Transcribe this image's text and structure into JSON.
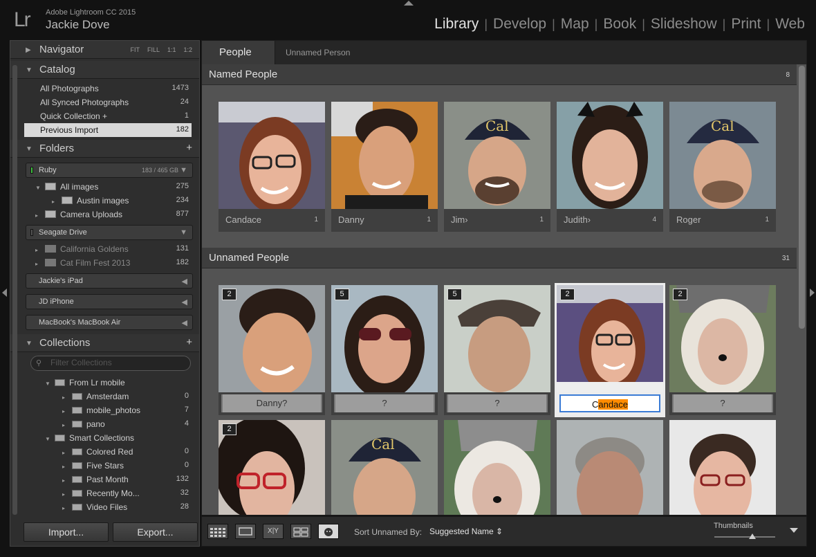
{
  "app": {
    "logo": "Lr",
    "version": "Adobe Lightroom CC 2015",
    "user": "Jackie Dove"
  },
  "modules": [
    "Library",
    "Develop",
    "Map",
    "Book",
    "Slideshow",
    "Print",
    "Web"
  ],
  "active_module": "Library",
  "navigator": {
    "title": "Navigator",
    "options": [
      "FIT",
      "FILL",
      "1:1",
      "1:2"
    ]
  },
  "catalog": {
    "title": "Catalog",
    "items": [
      {
        "label": "All Photographs",
        "count": "1473"
      },
      {
        "label": "All Synced Photographs",
        "count": "24"
      },
      {
        "label": "Quick Collection +",
        "count": "1"
      },
      {
        "label": "Previous Import",
        "count": "182"
      }
    ]
  },
  "folders": {
    "title": "Folders",
    "volume1": {
      "name": "Ruby",
      "size": "183 / 465 GB"
    },
    "items1": [
      {
        "label": "All images",
        "count": "275"
      },
      {
        "label": "Austin images",
        "count": "234"
      },
      {
        "label": "Camera Uploads",
        "count": "877"
      }
    ],
    "volume2": {
      "name": "Seagate Drive"
    },
    "items2": [
      {
        "label": "California Goldens",
        "count": "131"
      },
      {
        "label": "Cat Film Fest 2013",
        "count": "182"
      }
    ],
    "devices": [
      "Jackie's iPad",
      "JD iPhone",
      "MacBook's MacBook Air"
    ]
  },
  "collections": {
    "title": "Collections",
    "filter_placeholder": "Filter Collections",
    "sets": [
      {
        "label": "From Lr mobile"
      },
      {
        "label": "Smart Collections"
      }
    ],
    "mobile_items": [
      {
        "label": "Amsterdam",
        "count": "0"
      },
      {
        "label": "mobile_photos",
        "count": "7"
      },
      {
        "label": "pano",
        "count": "4"
      }
    ],
    "smart_items": [
      {
        "label": "Colored Red",
        "count": "0"
      },
      {
        "label": "Five Stars",
        "count": "0"
      },
      {
        "label": "Past Month",
        "count": "132"
      },
      {
        "label": "Recently Mo...",
        "count": "32"
      },
      {
        "label": "Video Files",
        "count": "28"
      }
    ]
  },
  "buttons": {
    "import": "Import...",
    "export": "Export..."
  },
  "tabs": {
    "people": "People",
    "unnamed": "Unnamed Person"
  },
  "named_section": {
    "title": "Named People",
    "count": "8",
    "people": [
      {
        "name": "Candace",
        "count": "1"
      },
      {
        "name": "Danny",
        "count": "1"
      },
      {
        "name": "Jim›",
        "count": "1"
      },
      {
        "name": "Judith›",
        "count": "4"
      },
      {
        "name": "Roger",
        "count": "1"
      }
    ]
  },
  "unnamed_section": {
    "title": "Unnamed People",
    "count": "31",
    "stacks": [
      {
        "badge": "2",
        "name": "Danny?"
      },
      {
        "badge": "5",
        "name": "?"
      },
      {
        "badge": "5",
        "name": "?"
      },
      {
        "badge": "2",
        "name_prefix": "C",
        "name_highlight": "andace"
      },
      {
        "badge": "2",
        "name": "?"
      }
    ],
    "row2_badges": [
      "2"
    ]
  },
  "toolbar": {
    "grid_icon": "grid-view-icon",
    "loupe_icon": "loupe-view-icon",
    "compare_label": "X|Y",
    "sort_label": "Sort Unnamed By:",
    "sort_value": "Suggested Name ⇕",
    "thumbnails_label": "Thumbnails"
  }
}
